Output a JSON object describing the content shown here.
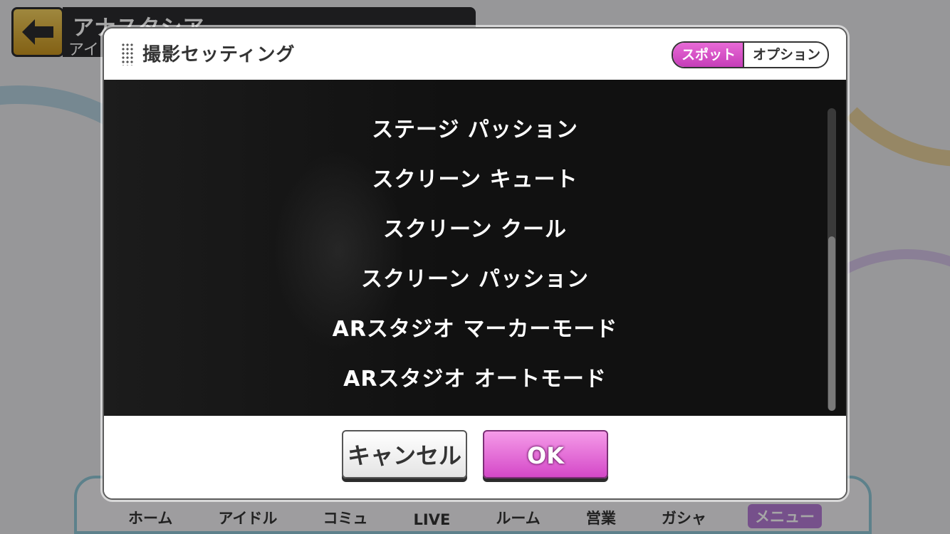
{
  "background": {
    "header": {
      "title": "アナスタシア",
      "subtitle": "アイ"
    },
    "nav_items": [
      "ホーム",
      "アイドル",
      "コミュ",
      "LIVE",
      "ルーム",
      "営業",
      "ガシャ",
      "メニュー"
    ]
  },
  "dialog": {
    "title": "撮影セッティング",
    "toggle": {
      "active": "スポット",
      "inactive": "オプション"
    },
    "options": [
      "ステージ パッション",
      "スクリーン キュート",
      "スクリーン クール",
      "スクリーン パッション",
      "ARスタジオ マーカーモード",
      "ARスタジオ オートモード"
    ],
    "cancel_label": "キャンセル",
    "ok_label": "OK"
  },
  "colors": {
    "accent_pink": "#d448c8",
    "list_bg": "#111111",
    "dialog_bg": "#ffffff"
  }
}
